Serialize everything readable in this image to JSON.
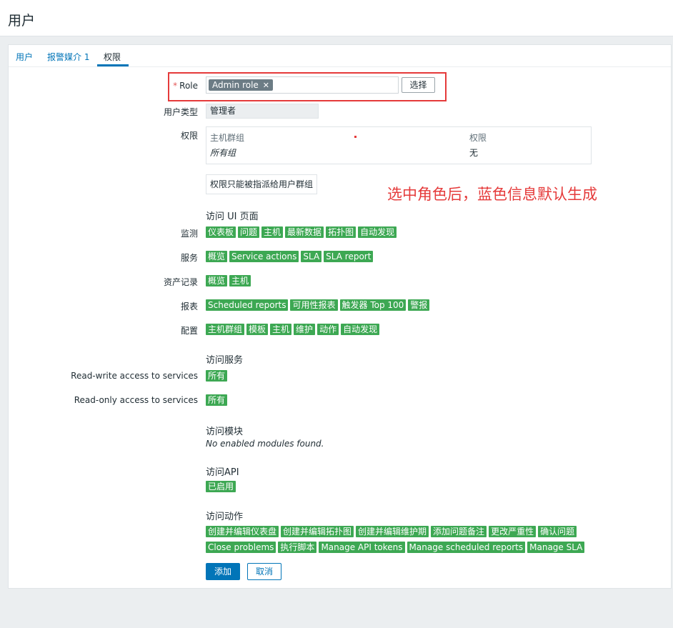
{
  "page": {
    "title": "用户"
  },
  "tabs": [
    {
      "label": "用户"
    },
    {
      "label": "报警媒介 1"
    },
    {
      "label": "权限"
    }
  ],
  "form": {
    "role_required_marker": "*",
    "role_label": "Role",
    "role_chip": "Admin role",
    "role_chip_remove": "✕",
    "select_button": "选择",
    "user_type_label": "用户类型",
    "user_type_value": "管理者",
    "permissions_label": "权限",
    "perm_headers": {
      "host_group": "主机群组",
      "permission": "权限"
    },
    "perm_row": {
      "host_group": "所有组",
      "permission": "无"
    },
    "perm_note": "权限只能被指派给用户群组"
  },
  "annotation": "选中角色后，蓝色信息默认生成",
  "ui_access": {
    "title": "访问 UI 页面",
    "rows": [
      {
        "label": "监测",
        "tags": [
          "仪表板",
          "问题",
          "主机",
          "最新数据",
          "拓扑图",
          "自动发现"
        ]
      },
      {
        "label": "服务",
        "tags": [
          "概览",
          "Service actions",
          "SLA",
          "SLA report"
        ]
      },
      {
        "label": "资产记录",
        "tags": [
          "概览",
          "主机"
        ]
      },
      {
        "label": "报表",
        "tags": [
          "Scheduled reports",
          "可用性报表",
          "触发器 Top 100",
          "警报"
        ]
      },
      {
        "label": "配置",
        "tags": [
          "主机群组",
          "模板",
          "主机",
          "维护",
          "动作",
          "自动发现"
        ]
      }
    ]
  },
  "services_access": {
    "title": "访问服务",
    "read_write_label": "Read-write access to services",
    "read_write_tag": "所有",
    "read_only_label": "Read-only access to services",
    "read_only_tag": "所有"
  },
  "modules_access": {
    "title": "访问模块",
    "empty_text": "No enabled modules found."
  },
  "api_access": {
    "title": "访问API",
    "tag": "已启用"
  },
  "actions_access": {
    "title": "访问动作",
    "row1": [
      "创建并编辑仪表盘",
      "创建并编辑拓扑图",
      "创建并编辑维护期",
      "添加问题备注",
      "更改严重性",
      "确认问题"
    ],
    "row2": [
      "Close problems",
      "执行脚本",
      "Manage API tokens",
      "Manage scheduled reports",
      "Manage SLA"
    ]
  },
  "buttons": {
    "add": "添加",
    "cancel": "取消"
  },
  "colors": {
    "accent": "#0275b8",
    "tag_green": "#3da853",
    "annotation_red": "#e53a3a"
  }
}
